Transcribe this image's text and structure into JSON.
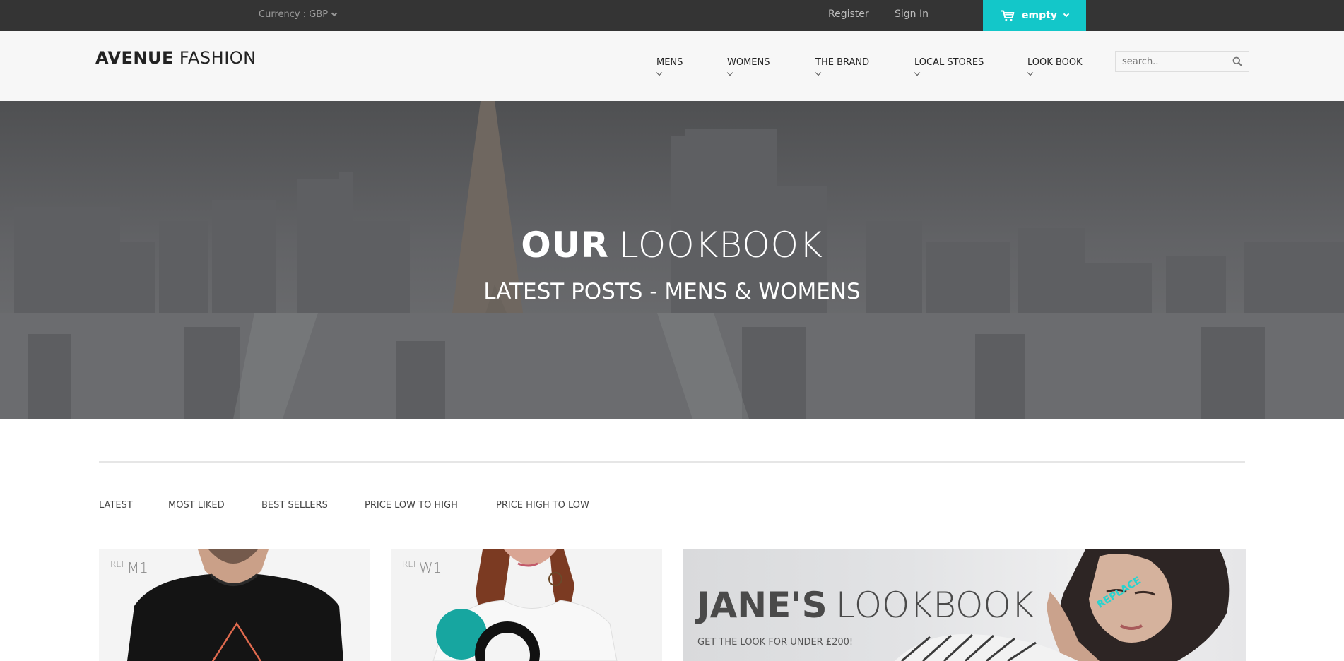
{
  "topbar": {
    "currency_label": "Currency : GBP",
    "register": "Register",
    "sign_in": "Sign In",
    "cart_label": "empty",
    "cart_color": "#13c7c9"
  },
  "header": {
    "logo_bold": "AVENUE",
    "logo_light": "FASHION",
    "nav": [
      "MENS",
      "WOMENS",
      "THE BRAND",
      "LOCAL STORES",
      "LOOK BOOK"
    ],
    "search_placeholder": "search.."
  },
  "hero": {
    "title_bold": "OUR",
    "title_light": "LOOKBOOK",
    "subtitle": "LATEST POSTS - MENS & WOMENS"
  },
  "filters": [
    "LATEST",
    "MOST LIKED",
    "BEST SELLERS",
    "PRICE LOW TO HIGH",
    "PRICE HIGH TO LOW"
  ],
  "products": [
    {
      "ref_prefix": "REF",
      "ref_code": "M1"
    },
    {
      "ref_prefix": "REF",
      "ref_code": "W1"
    }
  ],
  "lookbook": {
    "title_bold": "JANE'S",
    "title_light": "LOOKBOOK",
    "subtitle": "GET THE LOOK FOR UNDER £200!",
    "badge": "REPLACE"
  }
}
